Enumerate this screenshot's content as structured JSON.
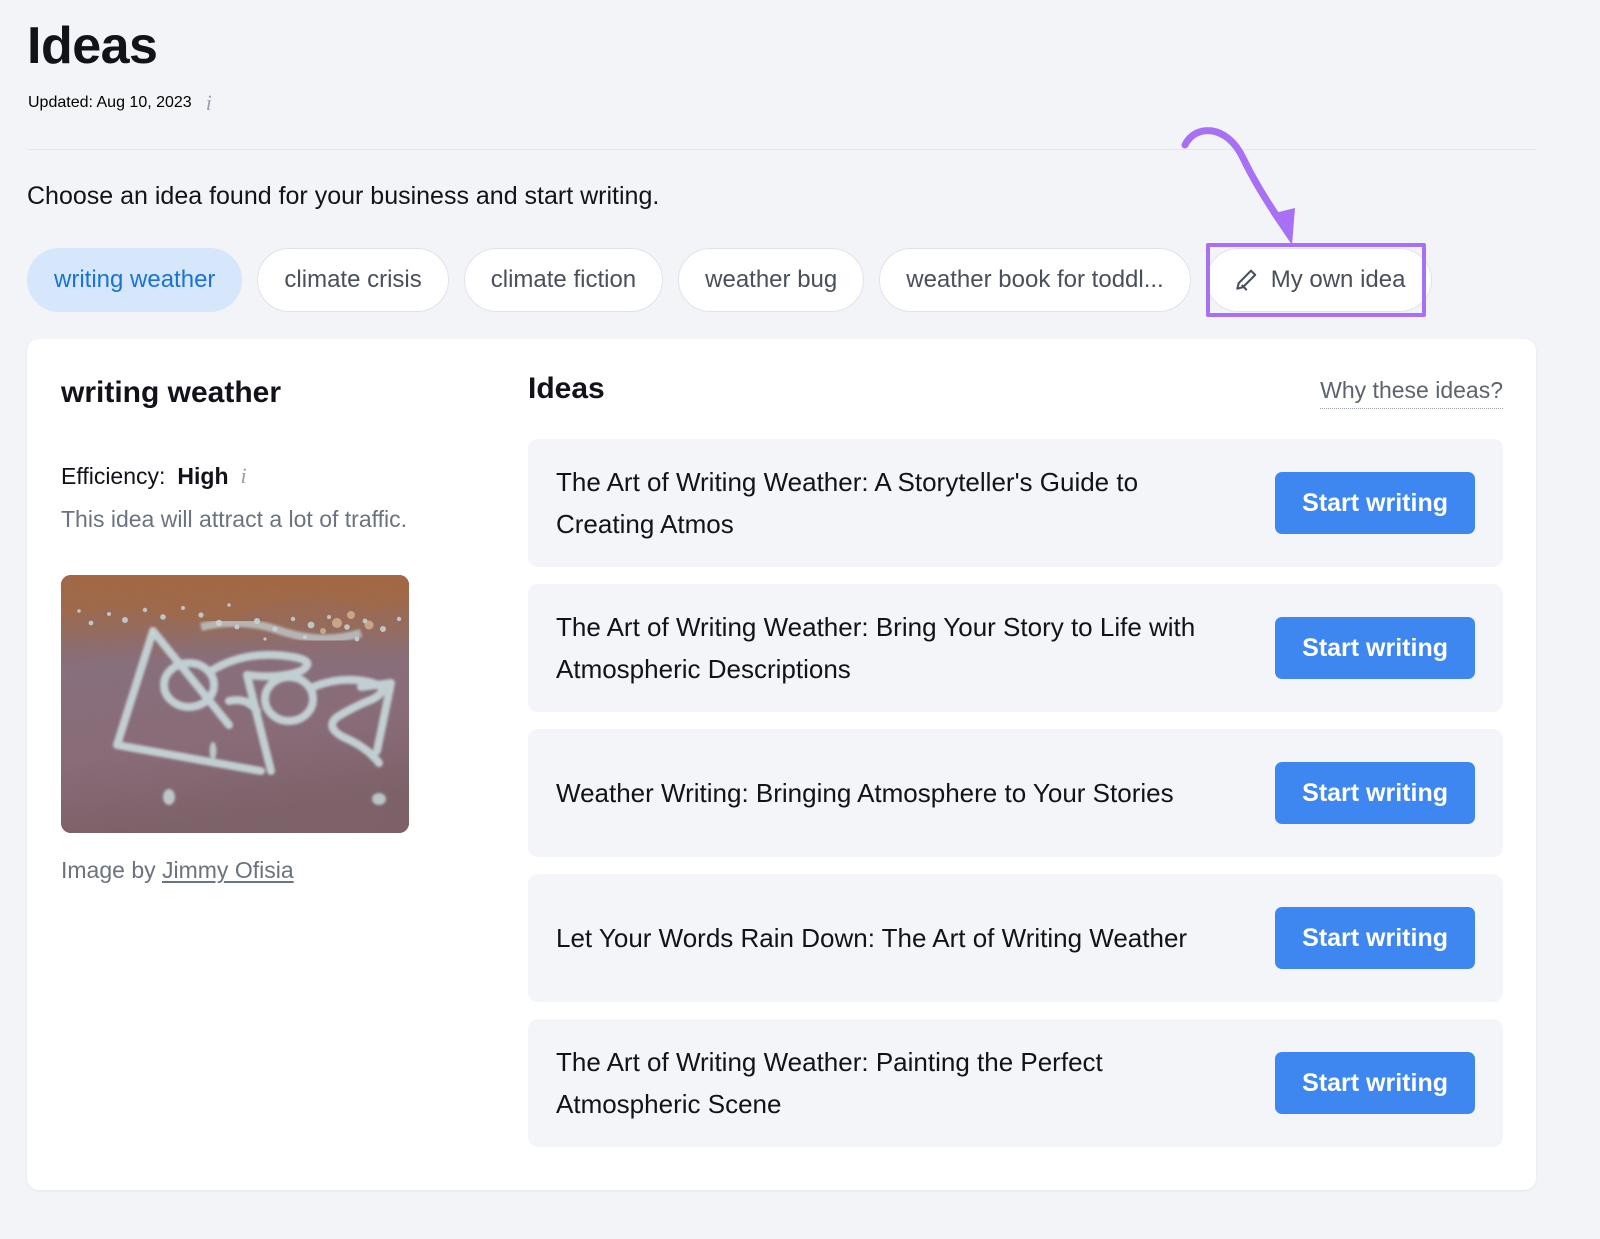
{
  "header": {
    "title": "Ideas",
    "updated_label": "Updated: Aug 10, 2023",
    "info_icon": "info-icon",
    "subtitle": "Choose an idea found for your business and start writing."
  },
  "pills": [
    {
      "label": "writing weather",
      "active": true
    },
    {
      "label": "climate crisis",
      "active": false
    },
    {
      "label": "climate fiction",
      "active": false
    },
    {
      "label": "weather bug",
      "active": false
    },
    {
      "label": "weather book for toddl...",
      "active": false
    },
    {
      "label": "My own idea",
      "active": false,
      "icon": "pencil-icon"
    }
  ],
  "annotation": {
    "color": "#a871f5",
    "target": "My own idea"
  },
  "left_panel": {
    "idea_name": "writing weather",
    "efficiency_label": "Efficiency:",
    "efficiency_value": "High",
    "efficiency_info_icon": "info-icon",
    "efficiency_description": "This idea will attract a lot of traffic.",
    "image_credit_prefix": "Image by ",
    "image_credit_author": "Jimmy Ofisia"
  },
  "right_panel": {
    "title": "Ideas",
    "why_link": "Why these ideas?",
    "ideas": [
      {
        "text": "The Art of Writing Weather: A Storyteller's Guide to Creating Atmos",
        "button": "Start writing"
      },
      {
        "text": "The Art of Writing Weather: Bring Your Story to Life with Atmospheric Descriptions",
        "button": "Start writing"
      },
      {
        "text": "Weather Writing: Bringing Atmosphere to Your Stories",
        "button": "Start writing"
      },
      {
        "text": "Let Your Words Rain Down: The Art of Writing Weather",
        "button": "Start writing"
      },
      {
        "text": "The Art of Writing Weather: Painting the Perfect Atmospheric Scene",
        "button": "Start writing"
      }
    ]
  },
  "colors": {
    "accent_blue": "#3f87f0",
    "active_pill_bg": "#d6e7fb",
    "active_pill_text": "#1a73d4",
    "annotation_purple": "#a871f5",
    "page_bg": "#f2f4f7",
    "row_bg": "#f3f5f8"
  }
}
